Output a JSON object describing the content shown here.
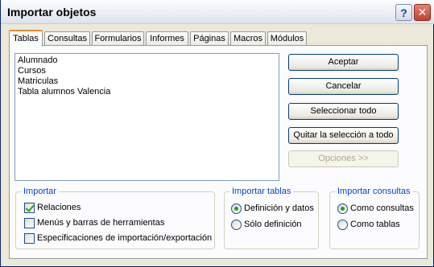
{
  "window": {
    "title": "Importar objetos",
    "help_glyph": "?",
    "close_glyph": "✕"
  },
  "tabs": [
    {
      "label": "Tablas",
      "active": true
    },
    {
      "label": "Consultas"
    },
    {
      "label": "Formularios"
    },
    {
      "label": "Informes"
    },
    {
      "label": "Páginas"
    },
    {
      "label": "Macros"
    },
    {
      "label": "Módulos"
    }
  ],
  "objects_list": [
    "Alumnado",
    "Cursos",
    "Matriculas",
    "Tabla alumnos Valencia"
  ],
  "buttons": {
    "accept": "Aceptar",
    "cancel": "Cancelar",
    "select_all": "Seleccionar todo",
    "deselect_all": "Quitar la selección a todo",
    "options": "Opciones >>"
  },
  "import_group": {
    "title": "Importar",
    "relations": "Relaciones",
    "menus": "Menús y barras de herramientas",
    "specs": "Especificaciones de importación/exportación"
  },
  "tables_group": {
    "title": "Importar tablas",
    "definition_data": "Definición y datos",
    "definition_only": "Sólo definición"
  },
  "queries_group": {
    "title": "Importar consultas",
    "as_queries": "Como consultas",
    "as_tables": "Como tablas"
  },
  "colors": {
    "accent_tab": "#e68b2c",
    "group_title": "#0046d5",
    "check_mark": "#21a121"
  }
}
